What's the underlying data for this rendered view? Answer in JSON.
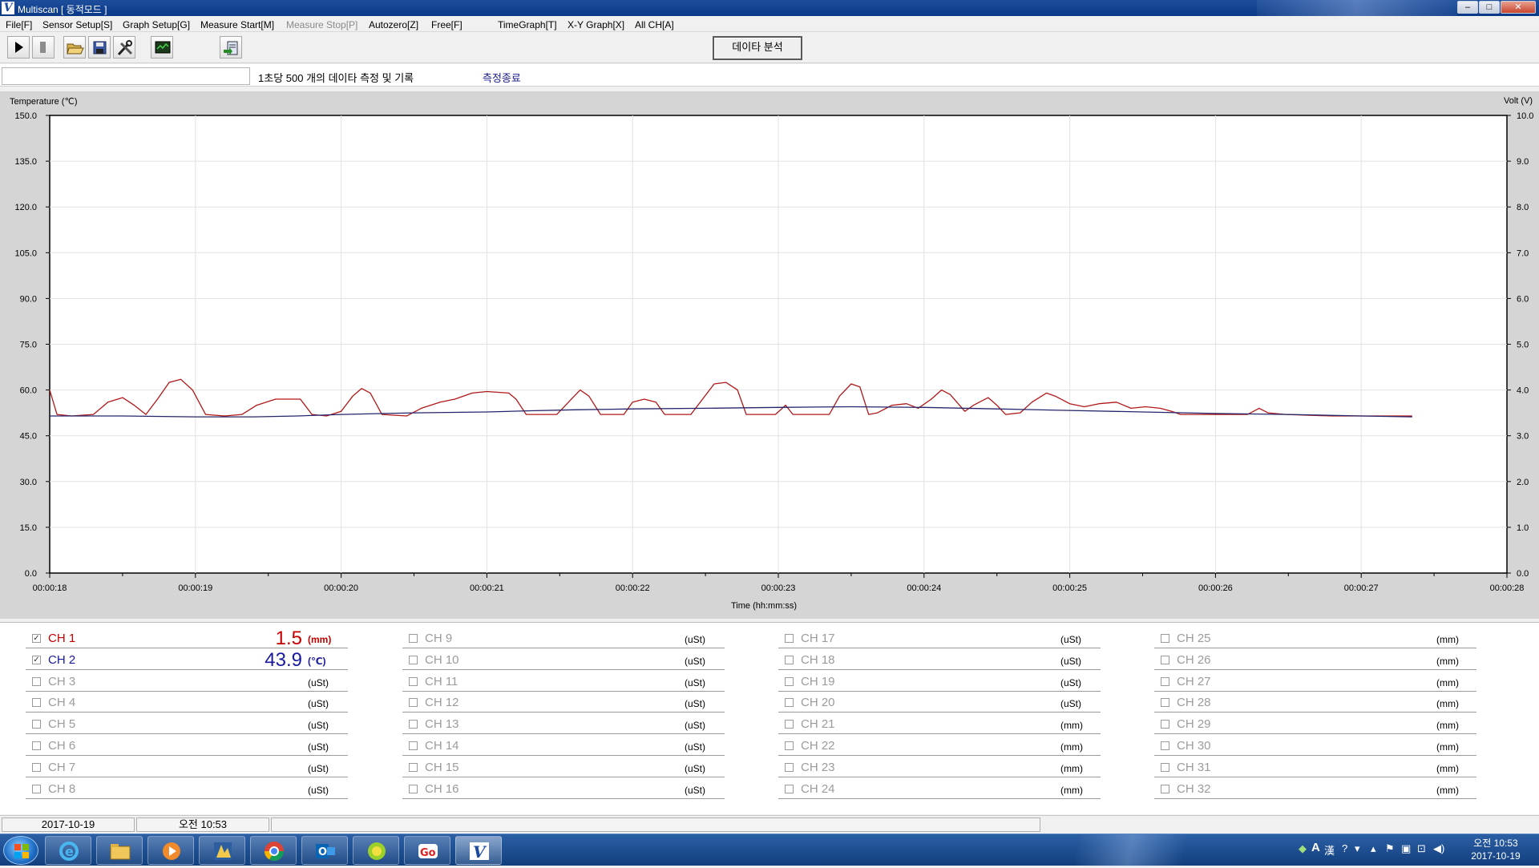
{
  "window": {
    "title": "Multiscan  [ 동적모드 ]",
    "min": "–",
    "max": "□",
    "close": "✕"
  },
  "menu": [
    {
      "label": "File[F]",
      "disabled": false
    },
    {
      "label": "Sensor Setup[S]",
      "disabled": false
    },
    {
      "label": "Graph Setup[G]",
      "disabled": false
    },
    {
      "label": "Measure Start[M]",
      "disabled": false
    },
    {
      "label": "Measure Stop[P]",
      "disabled": true
    },
    {
      "label": "Autozero[Z]",
      "disabled": false
    },
    {
      "label": "Free[F]",
      "disabled": false
    },
    {
      "label": "TimeGraph[T]",
      "disabled": false
    },
    {
      "label": "X-Y Graph[X]",
      "disabled": false
    },
    {
      "label": "All CH[A]",
      "disabled": false
    }
  ],
  "toolbar": {
    "icons": [
      "play-icon",
      "stop-icon",
      "open-folder-icon",
      "save-icon",
      "tools-icon",
      "monitor-icon",
      "export-icon"
    ],
    "analysis_label": "데이타 분석"
  },
  "status": {
    "message": "1초당 500 개의 데이타 측정 및 기록",
    "state": "측정종료"
  },
  "chart_data": {
    "type": "line",
    "title": "",
    "ylabel": "Temperature (℃)",
    "y2label": "Volt (V)",
    "xlabel": "Time (hh:mm:ss)",
    "ylim": [
      0,
      150
    ],
    "y2lim": [
      0,
      10
    ],
    "y_ticks": [
      "150.0",
      "135.0",
      "120.0",
      "105.0",
      "90.0",
      "75.0",
      "60.0",
      "45.0",
      "30.0",
      "15.0",
      "0.0"
    ],
    "y2_ticks": [
      "10.0",
      "9.0",
      "8.0",
      "7.0",
      "6.0",
      "5.0",
      "4.0",
      "3.0",
      "2.0",
      "1.0",
      "0.0"
    ],
    "x_ticks": [
      "00:00:18",
      "00:00:19",
      "00:00:20",
      "00:00:21",
      "00:00:22",
      "00:00:23",
      "00:00:24",
      "00:00:25",
      "00:00:26",
      "00:00:27",
      "00:00:28"
    ],
    "xlim_seconds": [
      18,
      28
    ],
    "grid": true,
    "series": [
      {
        "color": "#b01818",
        "points": [
          [
            18.0,
            60
          ],
          [
            18.05,
            52
          ],
          [
            18.15,
            51.5
          ],
          [
            18.3,
            52
          ],
          [
            18.4,
            56
          ],
          [
            18.5,
            57.5
          ],
          [
            18.58,
            55
          ],
          [
            18.66,
            52
          ],
          [
            18.74,
            57
          ],
          [
            18.82,
            62.5
          ],
          [
            18.9,
            63.5
          ],
          [
            18.98,
            60
          ],
          [
            19.07,
            52
          ],
          [
            19.2,
            51.5
          ],
          [
            19.32,
            52
          ],
          [
            19.42,
            55
          ],
          [
            19.55,
            57
          ],
          [
            19.72,
            57
          ],
          [
            19.8,
            52
          ],
          [
            19.9,
            51.5
          ],
          [
            20.0,
            53
          ],
          [
            20.08,
            58
          ],
          [
            20.14,
            60.5
          ],
          [
            20.2,
            59
          ],
          [
            20.28,
            52
          ],
          [
            20.45,
            51.5
          ],
          [
            20.55,
            54
          ],
          [
            20.68,
            56
          ],
          [
            20.78,
            57
          ],
          [
            20.9,
            59
          ],
          [
            21.0,
            59.5
          ],
          [
            21.15,
            59
          ],
          [
            21.2,
            57
          ],
          [
            21.27,
            52
          ],
          [
            21.48,
            52
          ],
          [
            21.56,
            56
          ],
          [
            21.64,
            60
          ],
          [
            21.7,
            58
          ],
          [
            21.78,
            52
          ],
          [
            21.94,
            52
          ],
          [
            22.0,
            56
          ],
          [
            22.08,
            57
          ],
          [
            22.16,
            56
          ],
          [
            22.22,
            52
          ],
          [
            22.4,
            52
          ],
          [
            22.48,
            57
          ],
          [
            22.56,
            62
          ],
          [
            22.64,
            62.5
          ],
          [
            22.72,
            60
          ],
          [
            22.78,
            52
          ],
          [
            22.98,
            52
          ],
          [
            23.05,
            55
          ],
          [
            23.1,
            52
          ],
          [
            23.35,
            52
          ],
          [
            23.42,
            58
          ],
          [
            23.5,
            62
          ],
          [
            23.56,
            61
          ],
          [
            23.62,
            52
          ],
          [
            23.68,
            52.5
          ],
          [
            23.78,
            55
          ],
          [
            23.88,
            55.5
          ],
          [
            23.96,
            54
          ],
          [
            24.05,
            57
          ],
          [
            24.12,
            60
          ],
          [
            24.18,
            58.5
          ],
          [
            24.28,
            53
          ],
          [
            24.34,
            55
          ],
          [
            24.44,
            57.5
          ],
          [
            24.5,
            55
          ],
          [
            24.56,
            52
          ],
          [
            24.66,
            52.5
          ],
          [
            24.74,
            56
          ],
          [
            24.84,
            59
          ],
          [
            24.9,
            58
          ],
          [
            25.0,
            55.5
          ],
          [
            25.1,
            54.5
          ],
          [
            25.2,
            55.5
          ],
          [
            25.32,
            56
          ],
          [
            25.42,
            54
          ],
          [
            25.52,
            54.5
          ],
          [
            25.62,
            54
          ],
          [
            25.7,
            53
          ],
          [
            25.76,
            52
          ],
          [
            25.94,
            52
          ],
          [
            26.02,
            52
          ],
          [
            26.22,
            52
          ],
          [
            26.3,
            54
          ],
          [
            26.36,
            52.5
          ],
          [
            26.48,
            52
          ],
          [
            26.8,
            51.5
          ],
          [
            27.15,
            51.5
          ],
          [
            27.35,
            51.5
          ]
        ]
      },
      {
        "color": "#25256a",
        "points": [
          [
            18.0,
            51.5
          ],
          [
            18.5,
            51.5
          ],
          [
            19.0,
            51.2
          ],
          [
            19.4,
            51.2
          ],
          [
            19.7,
            51.5
          ],
          [
            20.0,
            52
          ],
          [
            20.5,
            52.5
          ],
          [
            21.0,
            52.8
          ],
          [
            21.3,
            53.2
          ],
          [
            21.6,
            53.5
          ],
          [
            22.0,
            53.8
          ],
          [
            22.5,
            54
          ],
          [
            23.0,
            54.3
          ],
          [
            23.5,
            54.5
          ],
          [
            24.0,
            54.3
          ],
          [
            24.5,
            53.8
          ],
          [
            25.0,
            53.3
          ],
          [
            25.5,
            52.8
          ],
          [
            26.0,
            52.3
          ],
          [
            26.5,
            52
          ],
          [
            27.0,
            51.5
          ],
          [
            27.35,
            51.2
          ]
        ]
      }
    ]
  },
  "channels": [
    {
      "label": "CH 1",
      "unit": "(mm)",
      "checked": true,
      "active": true,
      "color": "#c40000",
      "value": "1.5"
    },
    {
      "label": "CH 2",
      "unit": "(℃)",
      "checked": true,
      "active": true,
      "color": "#1a1aa0",
      "value": "43.9"
    },
    {
      "label": "CH 3",
      "unit": "(uSt)",
      "checked": false,
      "active": false
    },
    {
      "label": "CH 4",
      "unit": "(uSt)",
      "checked": false,
      "active": false
    },
    {
      "label": "CH 5",
      "unit": "(uSt)",
      "checked": false,
      "active": false
    },
    {
      "label": "CH 6",
      "unit": "(uSt)",
      "checked": false,
      "active": false
    },
    {
      "label": "CH 7",
      "unit": "(uSt)",
      "checked": false,
      "active": false
    },
    {
      "label": "CH 8",
      "unit": "(uSt)",
      "checked": false,
      "active": false
    },
    {
      "label": "CH 9",
      "unit": "(uSt)",
      "checked": false,
      "active": false
    },
    {
      "label": "CH 10",
      "unit": "(uSt)",
      "checked": false,
      "active": false
    },
    {
      "label": "CH 11",
      "unit": "(uSt)",
      "checked": false,
      "active": false
    },
    {
      "label": "CH 12",
      "unit": "(uSt)",
      "checked": false,
      "active": false
    },
    {
      "label": "CH 13",
      "unit": "(uSt)",
      "checked": false,
      "active": false
    },
    {
      "label": "CH 14",
      "unit": "(uSt)",
      "checked": false,
      "active": false
    },
    {
      "label": "CH 15",
      "unit": "(uSt)",
      "checked": false,
      "active": false
    },
    {
      "label": "CH 16",
      "unit": "(uSt)",
      "checked": false,
      "active": false
    },
    {
      "label": "CH 17",
      "unit": "(uSt)",
      "checked": false,
      "active": false
    },
    {
      "label": "CH 18",
      "unit": "(uSt)",
      "checked": false,
      "active": false
    },
    {
      "label": "CH 19",
      "unit": "(uSt)",
      "checked": false,
      "active": false
    },
    {
      "label": "CH 20",
      "unit": "(uSt)",
      "checked": false,
      "active": false
    },
    {
      "label": "CH 21",
      "unit": "(mm)",
      "checked": false,
      "active": false
    },
    {
      "label": "CH 22",
      "unit": "(mm)",
      "checked": false,
      "active": false
    },
    {
      "label": "CH 23",
      "unit": "(mm)",
      "checked": false,
      "active": false
    },
    {
      "label": "CH 24",
      "unit": "(mm)",
      "checked": false,
      "active": false
    },
    {
      "label": "CH 25",
      "unit": "(mm)",
      "checked": false,
      "active": false
    },
    {
      "label": "CH 26",
      "unit": "(mm)",
      "checked": false,
      "active": false
    },
    {
      "label": "CH 27",
      "unit": "(mm)",
      "checked": false,
      "active": false
    },
    {
      "label": "CH 28",
      "unit": "(mm)",
      "checked": false,
      "active": false
    },
    {
      "label": "CH 29",
      "unit": "(mm)",
      "checked": false,
      "active": false
    },
    {
      "label": "CH 30",
      "unit": "(mm)",
      "checked": false,
      "active": false
    },
    {
      "label": "CH 31",
      "unit": "(mm)",
      "checked": false,
      "active": false
    },
    {
      "label": "CH 32",
      "unit": "(mm)",
      "checked": false,
      "active": false
    }
  ],
  "bottom_status": {
    "date": "2017-10-19",
    "time": "오전 10:53"
  },
  "taskbar": {
    "apps": [
      "internet-explorer-icon",
      "file-explorer-icon",
      "media-player-icon",
      "app-icon",
      "chrome-icon",
      "outlook-icon",
      "app-green-icon",
      "gom-icon",
      "multiscan-icon"
    ],
    "tray_lang": "A",
    "tray_hanja": "漢",
    "clock_time": "오전 10:53",
    "clock_date": "2017-10-19"
  }
}
